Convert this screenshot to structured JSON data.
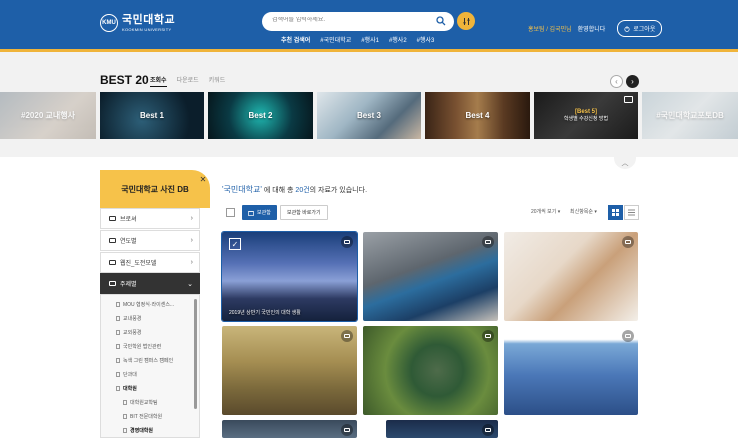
{
  "header": {
    "logo_mark": "KMU",
    "logo_ko": "국민대학교",
    "logo_en": "KOOKMIN UNIVERSITY",
    "search_placeholder": "검색어를 입력하세요.",
    "tags": [
      "추천 검색어",
      "#국민대학교",
      "#행사1",
      "#행사2",
      "#행사3"
    ],
    "user_name": "홍보팀 / 김국민님",
    "welcome": "환영합니다",
    "logout_label": "로그아웃"
  },
  "best": {
    "title": "BEST 20",
    "tabs": [
      "조회수",
      "다운로드",
      "키워드"
    ],
    "cards": [
      {
        "label": "#2020 교내행사",
        "sub": ""
      },
      {
        "label": "Best 1",
        "sub": ""
      },
      {
        "label": "Best 2",
        "sub": ""
      },
      {
        "label": "Best 3",
        "sub": ""
      },
      {
        "label": "Best 4",
        "sub": ""
      },
      {
        "label": "[Best 5]",
        "sub": "학생별 수강신청 방법"
      },
      {
        "label": "#국민대학교포토DB",
        "sub": ""
      }
    ]
  },
  "sidebar": {
    "title": "국민대학교 사진 DB",
    "items": [
      "브로셔",
      "연도별",
      "웹진_도전모델",
      "주제별"
    ],
    "sub_items": [
      "MOU 협정식·라이센스...",
      "교내풍경",
      "교외풍경",
      "국민학원 법인관련",
      "녹색 그린 캠퍼스 캠페인",
      "단과대",
      "대학원",
      "대학원교학팀",
      "BIT 전문대학원",
      "경영대학원"
    ]
  },
  "results": {
    "keyword": "'국민대학교'",
    "mid": "에 대해 총",
    "count": "20건",
    "tail": "의 자료가 있습니다.",
    "btn_download": "보관함",
    "btn_goto": "보관함 바로가기",
    "per_page": "20개씩 보기",
    "sort": "최신항목순",
    "first_caption": "2019년 상반기 국민인의 대학 생활"
  },
  "colors": {
    "brand": "#1e5fa8",
    "accent": "#f0b43a"
  }
}
